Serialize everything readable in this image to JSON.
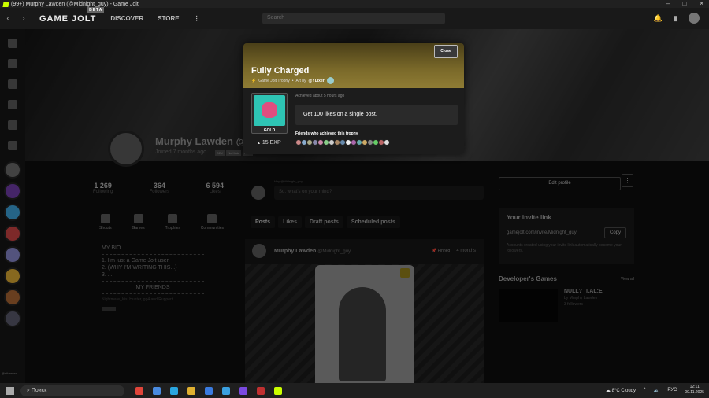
{
  "window": {
    "title": "(99+) Murphy Lawden (@Midnight_guy) - Game Jolt",
    "controls": [
      "–",
      "□",
      "✕"
    ]
  },
  "nav": {
    "brand": "GAME JOLT",
    "beta": "BETA",
    "discover": "DISCOVER",
    "store": "STORE",
    "more": "⋮",
    "search_placeholder": "Search"
  },
  "profile": {
    "name": "Murphy Lawden",
    "name_handle": "@Mi",
    "joined": "Joined 7 months ago",
    "badges": [
      "DEV",
      "No Hate",
      "Hero"
    ],
    "stats": [
      {
        "value": "1 269",
        "label": "Following"
      },
      {
        "value": "364",
        "label": "Followers"
      },
      {
        "value": "6 594",
        "label": "Likes"
      }
    ],
    "cats": [
      "Shouts",
      "Games",
      "Trophies",
      "Communities"
    ],
    "bio_title": "MY BIO",
    "bio_lines": [
      "1. I'm just a Game Jolt user",
      "2. (WHY I'M WRITING THIS...)",
      "3. ..."
    ],
    "friends_title": "MY FRIENDS",
    "friends_line": "Nightmare_Iris, Hunter, gg4 and Ruppert"
  },
  "composer": {
    "hey": "Hey @Midnight_guy",
    "placeholder": "So, what's on your mind?"
  },
  "tabs": [
    "Posts",
    "Likes",
    "Draft posts",
    "Scheduled posts"
  ],
  "post": {
    "author": "Murphy Lawden",
    "handle": "@Midnight_guy",
    "pinned": "Pinned",
    "ago": "4 months"
  },
  "right": {
    "edit": "Edit profile",
    "invite_title": "Your invite link",
    "invite_url": "gamejolt.com/invite/Midnight_guy",
    "copy": "Copy",
    "invite_note": "Accounts created using your invite link automatically become your followers.",
    "dev_title": "Developer's Games",
    "view_all": "View all",
    "game_title": "NULL?_T.AL:E",
    "game_by": "by Murphy Lawden",
    "game_followers": "3 followers"
  },
  "modal": {
    "close": "Close",
    "title": "Fully Charged",
    "kind": "Game Jolt Trophy",
    "art_by": "Art by",
    "artist": "@YLixer",
    "achieved": "Achieved about 5 hours ago",
    "description": "Get 100 likes on a single post.",
    "tier": "GOLD",
    "exp": "15 EXP",
    "friends_header": "Friends who achieved this trophy"
  },
  "sidebar": {
    "username": "@ritharuer"
  },
  "taskbar": {
    "search": "Поиск",
    "weather": "8°C Cloudy",
    "lang": "РУС",
    "time": "12:11",
    "date": "09.11.2025"
  },
  "colors": {
    "accent": "#ccff00",
    "trophy_gold": "#8f7c34"
  }
}
